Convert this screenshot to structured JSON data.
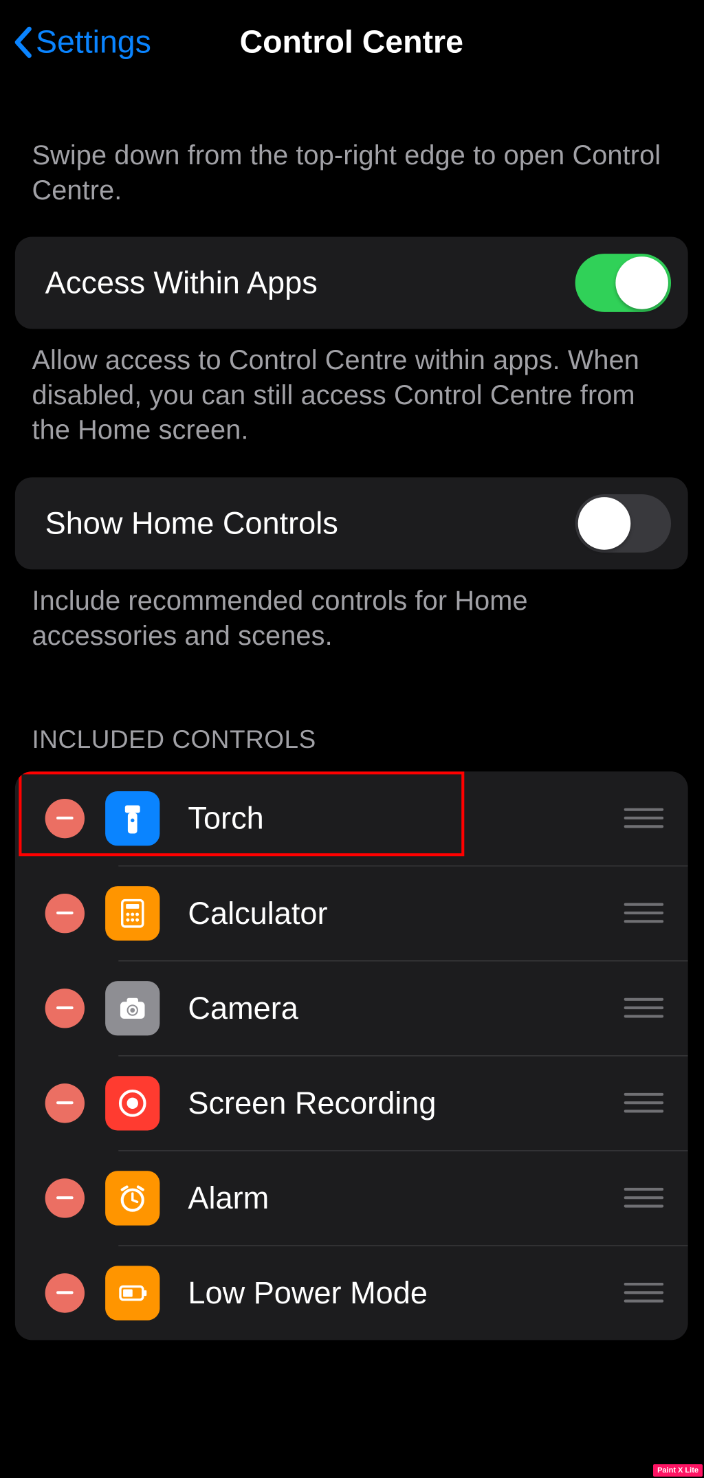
{
  "nav": {
    "back": "Settings",
    "title": "Control Centre"
  },
  "intro": "Swipe down from the top-right edge to open Control Centre.",
  "toggles": {
    "access": {
      "label": "Access Within Apps",
      "on": true,
      "desc": "Allow access to Control Centre within apps. When disabled, you can still access Control Centre from the Home screen."
    },
    "home": {
      "label": "Show Home Controls",
      "on": false,
      "desc": "Include recommended controls for Home accessories and scenes."
    }
  },
  "included_header": "INCLUDED CONTROLS",
  "items": [
    {
      "label": "Torch",
      "icon": "torch",
      "highlight": true
    },
    {
      "label": "Calculator",
      "icon": "calc",
      "highlight": false
    },
    {
      "label": "Camera",
      "icon": "cam",
      "highlight": false
    },
    {
      "label": "Screen Recording",
      "icon": "rec",
      "highlight": false
    },
    {
      "label": "Alarm",
      "icon": "alarm",
      "highlight": false
    },
    {
      "label": "Low Power Mode",
      "icon": "lpm",
      "highlight": false
    }
  ],
  "watermark": "Paint X Lite"
}
